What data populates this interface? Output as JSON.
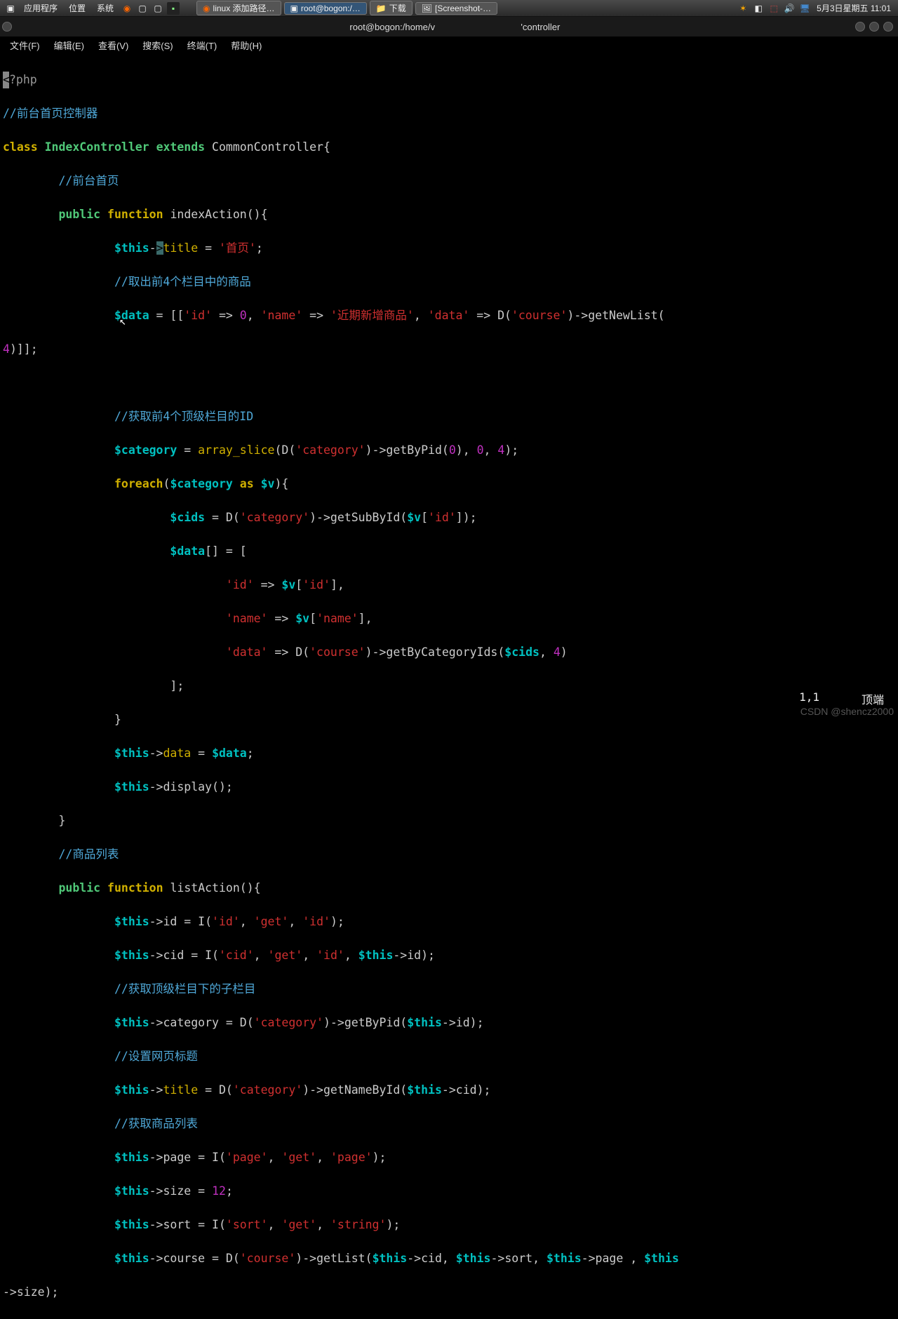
{
  "taskbar": {
    "menus": [
      "应用程序",
      "位置",
      "系统"
    ],
    "tasks": [
      {
        "icon": "🦊",
        "label": "linux 添加路径…"
      },
      {
        "icon": "▣",
        "label": "root@bogon:/…",
        "active": true
      },
      {
        "icon": "📁",
        "label": "下载"
      },
      {
        "icon": "🖼",
        "label": "[Screenshot-…"
      }
    ],
    "clock": "5月3日星期五 11:01"
  },
  "window": {
    "title_left": "root@bogon:/home/v",
    "title_right": "'controller"
  },
  "menubar": [
    "文件(F)",
    "编辑(E)",
    "查看(V)",
    "搜索(S)",
    "终端(T)",
    "帮助(H)"
  ],
  "status": {
    "pos": "1,1",
    "label": "顶端"
  },
  "watermark": "CSDN @shencz2000",
  "code": {
    "l1a": "<",
    "l1b": "?php",
    "l2": "//前台首页控制器",
    "l3": {
      "kw": "class",
      "name": "IndexController",
      "ext": "extends",
      "base": "CommonController"
    },
    "l4": "//前台首页",
    "l5": {
      "pub": "public",
      "fn": "function",
      "name": "indexAction"
    },
    "l6": {
      "v": "$this",
      "t": "title",
      "eq": " = ",
      "s": "'首页'"
    },
    "l7": "//取出前4个栏目中的商品",
    "l8": {
      "v": "$data",
      "s1": "'id'",
      "n1": "0",
      "s2": "'name'",
      "s3": "'近期新增商品'",
      "s4": "'data'",
      "s5": "'course'",
      "fn": "getNewList"
    },
    "l8b": "4",
    "l9": "//获取前4个顶级栏目的ID",
    "l10": {
      "v": "$category",
      "fn": "array_slice",
      "s": "'category'",
      "m": "getByPid",
      "n0": "0",
      "n1": "0",
      "n2": "4"
    },
    "l11": {
      "kw": "foreach",
      "v1": "$category",
      "as": "as",
      "v2": "$v"
    },
    "l12": {
      "v": "$cids",
      "s": "'category'",
      "m": "getSubById",
      "v2": "$v",
      "k": "'id'"
    },
    "l13": {
      "v": "$data"
    },
    "l14": {
      "s": "'id'",
      "v": "$v",
      "k": "'id'"
    },
    "l15": {
      "s": "'name'",
      "v": "$v",
      "k": "'name'"
    },
    "l16": {
      "s": "'data'",
      "s2": "'course'",
      "m": "getByCategoryIds",
      "v": "$cids",
      "n": "4"
    },
    "l17": {
      "v1": "$this",
      "m": "data",
      "v2": "$data"
    },
    "l18": {
      "v": "$this",
      "m": "display"
    },
    "l19": "//商品列表",
    "l20": {
      "pub": "public",
      "fn": "function",
      "name": "listAction"
    },
    "l21": {
      "v": "$this",
      "m": "id",
      "s1": "'id'",
      "s2": "'get'",
      "s3": "'id'"
    },
    "l22": {
      "v": "$this",
      "m": "cid",
      "s1": "'cid'",
      "s2": "'get'",
      "s3": "'id'",
      "v2": "$this",
      "m2": "id"
    },
    "l23": "//获取顶级栏目下的子栏目",
    "l24": {
      "v": "$this",
      "m": "category",
      "s": "'category'",
      "fn": "getByPid",
      "v2": "$this",
      "m2": "id"
    },
    "l25": "//设置网页标题",
    "l26": {
      "v": "$this",
      "m": "title",
      "s": "'category'",
      "fn": "getNameById",
      "v2": "$this",
      "m2": "cid"
    },
    "l27": "//获取商品列表",
    "l28": {
      "v": "$this",
      "m": "page",
      "s1": "'page'",
      "s2": "'get'",
      "s3": "'page'"
    },
    "l29": {
      "v": "$this",
      "m": "size",
      "n": "12"
    },
    "l30": {
      "v": "$this",
      "m": "sort",
      "s1": "'sort'",
      "s2": "'get'",
      "s3": "'string'"
    },
    "l31": {
      "v": "$this",
      "m": "course",
      "s": "'course'",
      "fn": "getList",
      "v2": "$this",
      "m2": "cid",
      "v3": "$this",
      "m3": "sort",
      "v4": "$this",
      "m4": "page",
      "v5": "$this"
    },
    "l31b": "size"
  }
}
